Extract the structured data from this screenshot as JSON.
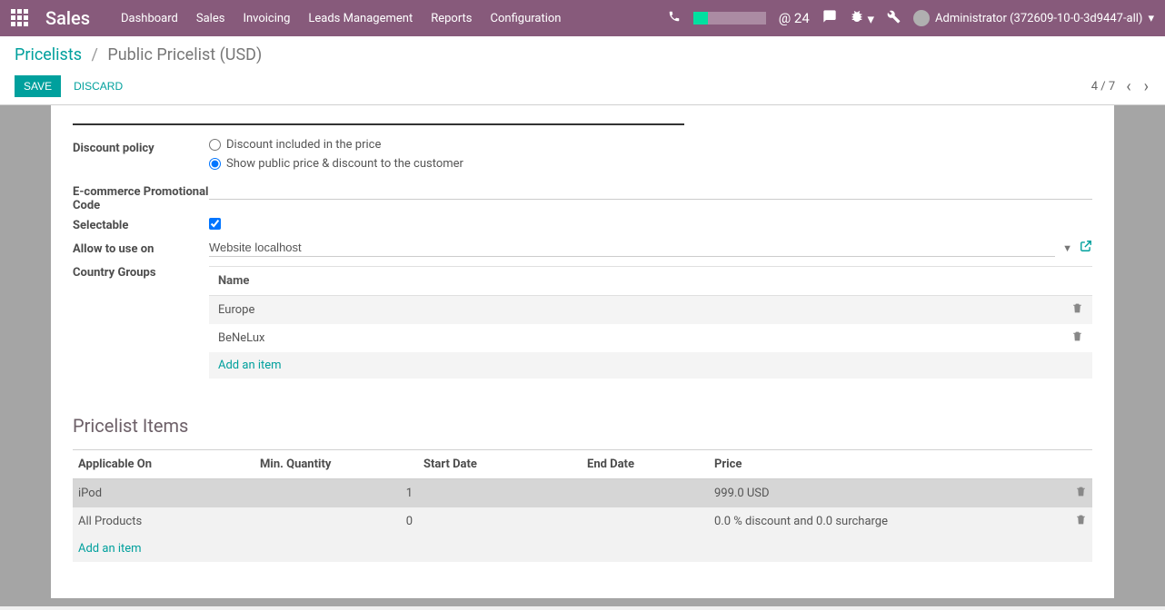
{
  "navbar": {
    "brand": "Sales",
    "menu": [
      "Dashboard",
      "Sales",
      "Invoicing",
      "Leads Management",
      "Reports",
      "Configuration"
    ],
    "mentions": "@ 24",
    "user": "Administrator (372609-10-0-3d9447-all)"
  },
  "breadcrumb": {
    "root": "Pricelists",
    "current": "Public Pricelist (USD)"
  },
  "buttons": {
    "save": "SAVE",
    "discard": "DISCARD"
  },
  "pager": {
    "text": "4 / 7"
  },
  "form": {
    "discount_policy_label": "Discount policy",
    "discount_policy_options": {
      "included": "Discount included in the price",
      "show_public": "Show public price & discount to the customer"
    },
    "ecom_code_label": "E-commerce Promotional Code",
    "selectable_label": "Selectable",
    "allow_use_label": "Allow to use on",
    "allow_use_value": "Website localhost",
    "country_groups_label": "Country Groups",
    "country_groups_header": "Name",
    "country_groups": [
      "Europe",
      "BeNeLux"
    ],
    "add_item": "Add an item"
  },
  "pricelist_items": {
    "title": "Pricelist Items",
    "headers": {
      "applicable_on": "Applicable On",
      "min_qty": "Min. Quantity",
      "start_date": "Start Date",
      "end_date": "End Date",
      "price": "Price"
    },
    "rows": [
      {
        "applicable_on": "iPod",
        "min_qty": "1",
        "start_date": "",
        "end_date": "",
        "price": "999.0 USD"
      },
      {
        "applicable_on": "All Products",
        "min_qty": "0",
        "start_date": "",
        "end_date": "",
        "price": "0.0 % discount and 0.0 surcharge"
      }
    ],
    "add_item": "Add an item"
  }
}
